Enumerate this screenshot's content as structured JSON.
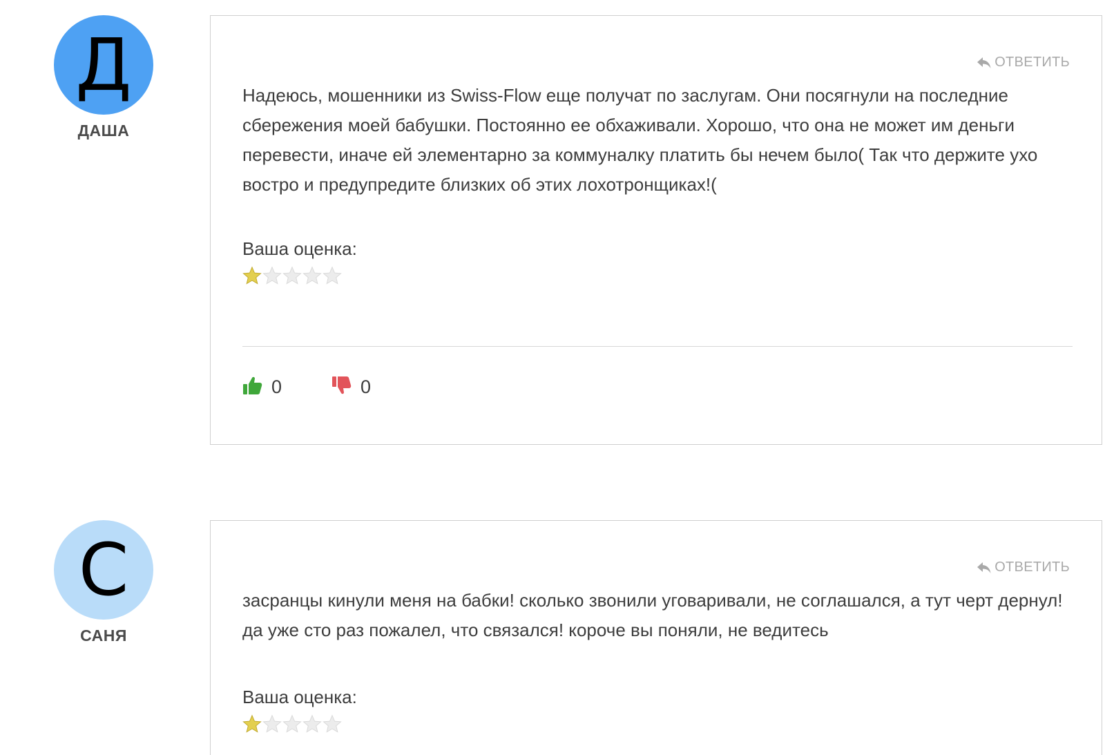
{
  "comments": [
    {
      "author_initial": "Д",
      "author_name": "ДАША",
      "avatar_color": "#4ea1f3",
      "reply_label": "ОТВЕТИТЬ",
      "text": "Надеюсь, мошенники из Swiss-Flow еще получат по заслугам. Они посягнули на последние сбережения моей бабушки. Постоянно ее обхаживали. Хорошо, что она не может им деньги перевести, иначе ей элементарно за коммуналку платить бы нечем было( Так что держите ухо востро и предупредите близких об этих лохотронщиках!(",
      "rating_label": "Ваша оценка:",
      "rating": 1,
      "rating_max": 5,
      "likes": "0",
      "dislikes": "0"
    },
    {
      "author_initial": "С",
      "author_name": "САНЯ",
      "avatar_color": "#b9dcf9",
      "reply_label": "ОТВЕТИТЬ",
      "text": "засранцы кинули меня на бабки! сколько звонили уговаривали, не соглашался, а тут черт дернул! да уже сто раз пожалел, что связался! короче вы поняли, не ведитесь",
      "rating_label": "Ваша оценка:",
      "rating": 1,
      "rating_max": 5
    }
  ],
  "colors": {
    "like_icon": "#3fa73a",
    "dislike_icon": "#e2545a",
    "star_filled": "#e3cf4f",
    "star_empty": "#e6e6e6",
    "reply_text": "#a9a9a9"
  },
  "icons": {
    "reply": "reply-arrow-icon",
    "like": "thumbs-up-icon",
    "dislike": "thumbs-down-icon",
    "star": "star-icon"
  }
}
